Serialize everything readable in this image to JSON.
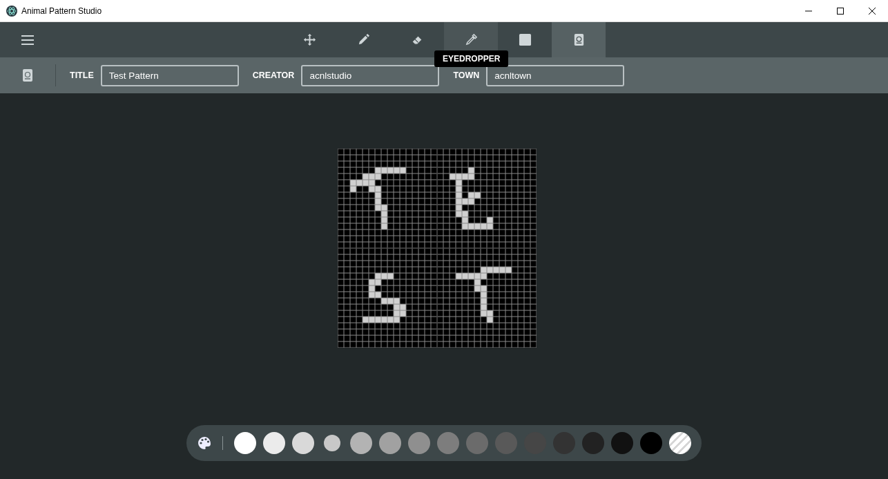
{
  "window": {
    "title": "Animal Pattern Studio"
  },
  "toolbar": {
    "tools": [
      {
        "kind": "move",
        "selected": false,
        "hovered": false
      },
      {
        "kind": "pencil",
        "selected": false,
        "hovered": false
      },
      {
        "kind": "eraser",
        "selected": false,
        "hovered": false
      },
      {
        "kind": "eyedropper",
        "selected": false,
        "hovered": true
      },
      {
        "kind": "fill",
        "selected": false,
        "hovered": false
      },
      {
        "kind": "passport",
        "selected": true,
        "hovered": false
      }
    ],
    "tooltip": "EYEDROPPER"
  },
  "details": {
    "fields": [
      {
        "label": "TITLE",
        "value": "Test Pattern"
      },
      {
        "label": "CREATOR",
        "value": "acnlstudio"
      },
      {
        "label": "TOWN",
        "value": "acnltown"
      }
    ]
  },
  "palette": {
    "swatches": [
      {
        "kind": "color",
        "color": "#ffffff",
        "selected": false
      },
      {
        "kind": "color",
        "color": "#ebebeb",
        "selected": false
      },
      {
        "kind": "color",
        "color": "#d9d9d9",
        "selected": false
      },
      {
        "kind": "color",
        "color": "#c8c8c8",
        "selected": true
      },
      {
        "kind": "color",
        "color": "#b3b3b3",
        "selected": false
      },
      {
        "kind": "color",
        "color": "#a1a1a1",
        "selected": false
      },
      {
        "kind": "color",
        "color": "#8f8f8f",
        "selected": false
      },
      {
        "kind": "color",
        "color": "#7d7d7d",
        "selected": false
      },
      {
        "kind": "color",
        "color": "#6b6b6b",
        "selected": false
      },
      {
        "kind": "color",
        "color": "#595959",
        "selected": false
      },
      {
        "kind": "color",
        "color": "#464646",
        "selected": false
      },
      {
        "kind": "color",
        "color": "#333333",
        "selected": false
      },
      {
        "kind": "color",
        "color": "#222222",
        "selected": false
      },
      {
        "kind": "color",
        "color": "#111111",
        "selected": false
      },
      {
        "kind": "color",
        "color": "#000000",
        "selected": false
      },
      {
        "kind": "transparent",
        "selected": false
      }
    ]
  }
}
